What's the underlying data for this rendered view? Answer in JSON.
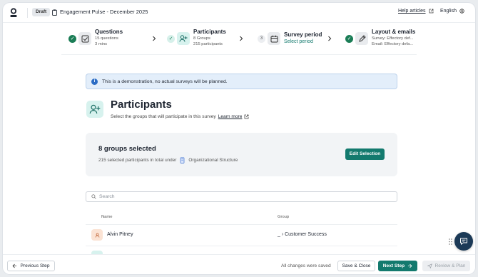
{
  "header": {
    "status_badge": "Draft",
    "survey_title": "Engagement Pulse - December 2025",
    "help_link": "Help articles",
    "language": "English"
  },
  "steps": [
    {
      "title": "Questions",
      "sub1": "15 questions",
      "sub2": "3 mins",
      "state": "complete",
      "icon": "question-check-icon"
    },
    {
      "title": "Participants",
      "sub1": "8 Groups",
      "sub2": "215 participants",
      "state": "active",
      "icon": "add-user-icon"
    },
    {
      "number": "3",
      "title": "Survey period",
      "link": "Select period",
      "state": "pending",
      "icon": "calendar-icon"
    },
    {
      "title": "Layout & emails",
      "sub1": "Survey: Effectory def...",
      "sub2": "Email: Effectory defa...",
      "state": "complete",
      "icon": "pen-icon"
    }
  ],
  "banner": {
    "text": "This is a demonstration, no actual surveys will be planned."
  },
  "page": {
    "title": "Participants",
    "subtitle": "Select the groups that will participate in this survey",
    "learn_more": "Learn more"
  },
  "selection_card": {
    "title": "8 groups selected",
    "sub_text": "215 selected participants in total under",
    "structure": "Organizational Structure",
    "edit_button": "Edit Selection"
  },
  "search": {
    "placeholder": "Search"
  },
  "table": {
    "columns": [
      "Name",
      "Group"
    ],
    "rows": [
      {
        "name": "Alvin Pitney",
        "group": "_ › Customer Success"
      }
    ]
  },
  "footer": {
    "previous": "Previous Step",
    "saved_status": "All changes were saved",
    "save_close": "Save & Close",
    "next": "Next Step",
    "review": "Review & Plan"
  },
  "colors": {
    "accent": "#137a6e",
    "complete": "#1b7d56",
    "info": "#2b6cc4",
    "chat_button": "#1c3a57"
  }
}
